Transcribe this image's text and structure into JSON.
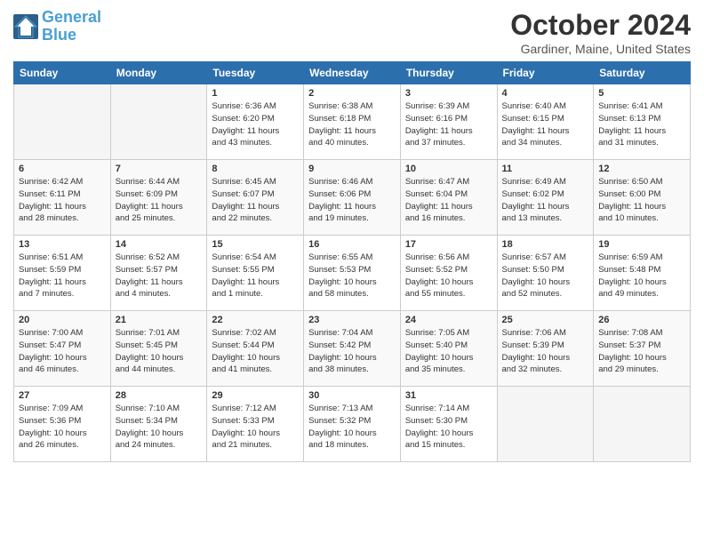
{
  "header": {
    "logo_line1": "General",
    "logo_line2": "Blue",
    "title": "October 2024",
    "subtitle": "Gardiner, Maine, United States"
  },
  "days_of_week": [
    "Sunday",
    "Monday",
    "Tuesday",
    "Wednesday",
    "Thursday",
    "Friday",
    "Saturday"
  ],
  "weeks": [
    [
      {
        "num": "",
        "info": ""
      },
      {
        "num": "",
        "info": ""
      },
      {
        "num": "1",
        "info": "Sunrise: 6:36 AM\nSunset: 6:20 PM\nDaylight: 11 hours\nand 43 minutes."
      },
      {
        "num": "2",
        "info": "Sunrise: 6:38 AM\nSunset: 6:18 PM\nDaylight: 11 hours\nand 40 minutes."
      },
      {
        "num": "3",
        "info": "Sunrise: 6:39 AM\nSunset: 6:16 PM\nDaylight: 11 hours\nand 37 minutes."
      },
      {
        "num": "4",
        "info": "Sunrise: 6:40 AM\nSunset: 6:15 PM\nDaylight: 11 hours\nand 34 minutes."
      },
      {
        "num": "5",
        "info": "Sunrise: 6:41 AM\nSunset: 6:13 PM\nDaylight: 11 hours\nand 31 minutes."
      }
    ],
    [
      {
        "num": "6",
        "info": "Sunrise: 6:42 AM\nSunset: 6:11 PM\nDaylight: 11 hours\nand 28 minutes."
      },
      {
        "num": "7",
        "info": "Sunrise: 6:44 AM\nSunset: 6:09 PM\nDaylight: 11 hours\nand 25 minutes."
      },
      {
        "num": "8",
        "info": "Sunrise: 6:45 AM\nSunset: 6:07 PM\nDaylight: 11 hours\nand 22 minutes."
      },
      {
        "num": "9",
        "info": "Sunrise: 6:46 AM\nSunset: 6:06 PM\nDaylight: 11 hours\nand 19 minutes."
      },
      {
        "num": "10",
        "info": "Sunrise: 6:47 AM\nSunset: 6:04 PM\nDaylight: 11 hours\nand 16 minutes."
      },
      {
        "num": "11",
        "info": "Sunrise: 6:49 AM\nSunset: 6:02 PM\nDaylight: 11 hours\nand 13 minutes."
      },
      {
        "num": "12",
        "info": "Sunrise: 6:50 AM\nSunset: 6:00 PM\nDaylight: 11 hours\nand 10 minutes."
      }
    ],
    [
      {
        "num": "13",
        "info": "Sunrise: 6:51 AM\nSunset: 5:59 PM\nDaylight: 11 hours\nand 7 minutes."
      },
      {
        "num": "14",
        "info": "Sunrise: 6:52 AM\nSunset: 5:57 PM\nDaylight: 11 hours\nand 4 minutes."
      },
      {
        "num": "15",
        "info": "Sunrise: 6:54 AM\nSunset: 5:55 PM\nDaylight: 11 hours\nand 1 minute."
      },
      {
        "num": "16",
        "info": "Sunrise: 6:55 AM\nSunset: 5:53 PM\nDaylight: 10 hours\nand 58 minutes."
      },
      {
        "num": "17",
        "info": "Sunrise: 6:56 AM\nSunset: 5:52 PM\nDaylight: 10 hours\nand 55 minutes."
      },
      {
        "num": "18",
        "info": "Sunrise: 6:57 AM\nSunset: 5:50 PM\nDaylight: 10 hours\nand 52 minutes."
      },
      {
        "num": "19",
        "info": "Sunrise: 6:59 AM\nSunset: 5:48 PM\nDaylight: 10 hours\nand 49 minutes."
      }
    ],
    [
      {
        "num": "20",
        "info": "Sunrise: 7:00 AM\nSunset: 5:47 PM\nDaylight: 10 hours\nand 46 minutes."
      },
      {
        "num": "21",
        "info": "Sunrise: 7:01 AM\nSunset: 5:45 PM\nDaylight: 10 hours\nand 44 minutes."
      },
      {
        "num": "22",
        "info": "Sunrise: 7:02 AM\nSunset: 5:44 PM\nDaylight: 10 hours\nand 41 minutes."
      },
      {
        "num": "23",
        "info": "Sunrise: 7:04 AM\nSunset: 5:42 PM\nDaylight: 10 hours\nand 38 minutes."
      },
      {
        "num": "24",
        "info": "Sunrise: 7:05 AM\nSunset: 5:40 PM\nDaylight: 10 hours\nand 35 minutes."
      },
      {
        "num": "25",
        "info": "Sunrise: 7:06 AM\nSunset: 5:39 PM\nDaylight: 10 hours\nand 32 minutes."
      },
      {
        "num": "26",
        "info": "Sunrise: 7:08 AM\nSunset: 5:37 PM\nDaylight: 10 hours\nand 29 minutes."
      }
    ],
    [
      {
        "num": "27",
        "info": "Sunrise: 7:09 AM\nSunset: 5:36 PM\nDaylight: 10 hours\nand 26 minutes."
      },
      {
        "num": "28",
        "info": "Sunrise: 7:10 AM\nSunset: 5:34 PM\nDaylight: 10 hours\nand 24 minutes."
      },
      {
        "num": "29",
        "info": "Sunrise: 7:12 AM\nSunset: 5:33 PM\nDaylight: 10 hours\nand 21 minutes."
      },
      {
        "num": "30",
        "info": "Sunrise: 7:13 AM\nSunset: 5:32 PM\nDaylight: 10 hours\nand 18 minutes."
      },
      {
        "num": "31",
        "info": "Sunrise: 7:14 AM\nSunset: 5:30 PM\nDaylight: 10 hours\nand 15 minutes."
      },
      {
        "num": "",
        "info": ""
      },
      {
        "num": "",
        "info": ""
      }
    ]
  ]
}
